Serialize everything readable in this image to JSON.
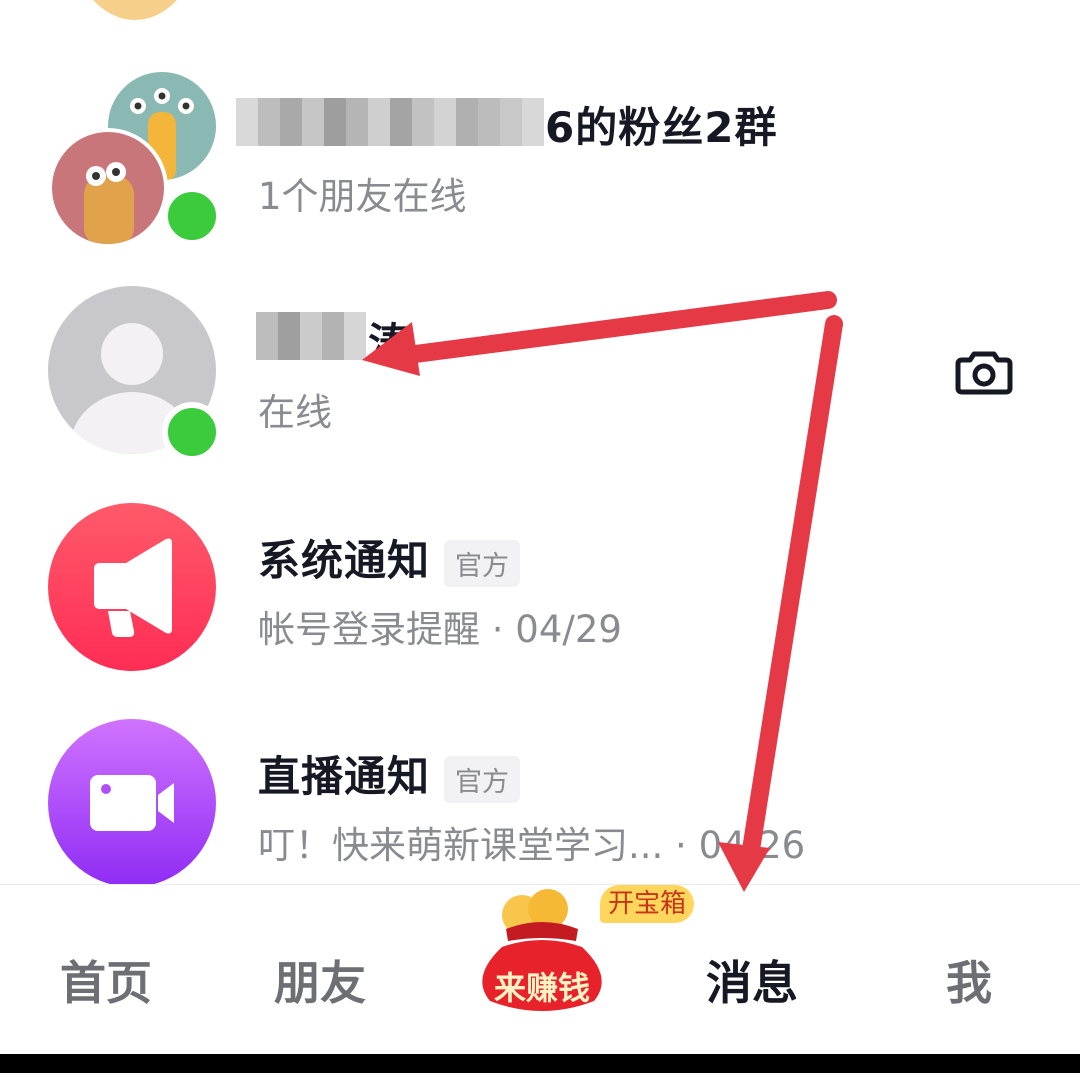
{
  "conversations": [
    {
      "name_visible": "6的粉丝2群",
      "subtitle": "1个朋友在线",
      "online": true
    },
    {
      "name_visible": "涛",
      "subtitle": "在线",
      "online": true,
      "action_icon": "camera-icon"
    },
    {
      "name": "系统通知",
      "badge": "官方",
      "subtitle": "帐号登录提醒 · 04/29",
      "icon": "megaphone-icon",
      "gradient": [
        "#ff5a6a",
        "#ff2d55"
      ]
    },
    {
      "name": "直播通知",
      "badge": "官方",
      "subtitle": "叮！快来萌新课堂学习... · 04/26",
      "icon": "video-camera-icon",
      "gradient": [
        "#d073ff",
        "#8f2cf5"
      ]
    }
  ],
  "tabbar": {
    "home": "首页",
    "friends": "朋友",
    "earn": "来赚钱",
    "earn_badge": "开宝箱",
    "messages": "消息",
    "me": "我",
    "active": "messages"
  },
  "colors": {
    "online": "#3bcb3d",
    "annotation_arrow": "#e63946",
    "earn_red": "#e8222b",
    "earn_badge_bg": "#ffd65c"
  }
}
